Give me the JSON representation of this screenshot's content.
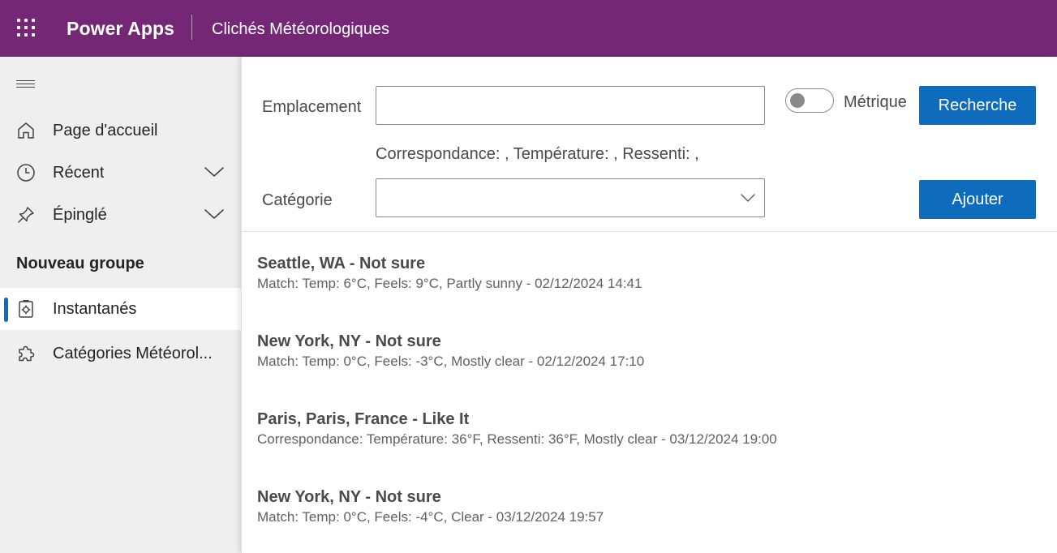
{
  "header": {
    "app_name": "Power Apps",
    "page_title": "Clichés Météorologiques",
    "bg_color": "#742774"
  },
  "sidebar": {
    "items": [
      {
        "label": "Page d'accueil",
        "icon": "home-icon"
      },
      {
        "label": "Récent",
        "icon": "clock-icon",
        "expandable": true
      },
      {
        "label": "Épinglé",
        "icon": "pin-icon",
        "expandable": true
      }
    ],
    "group_title": "Nouveau groupe",
    "group_items": [
      {
        "label": "Instantanés",
        "icon": "snapshot-icon",
        "selected": true
      },
      {
        "label": "Catégories Météorol...",
        "icon": "puzzle-icon",
        "selected": false
      }
    ]
  },
  "form": {
    "location_label": "Emplacement",
    "location_value": "",
    "metric_label": "Métrique",
    "metric_on": false,
    "search_button": "Recherche",
    "result_line": "Correspondance: , Température: , Ressenti: ,",
    "category_label": "Catégorie",
    "category_value": "",
    "add_button": "Ajouter",
    "accent_color": "#0f6cbd"
  },
  "snapshots": [
    {
      "title": "Seattle, WA - Not sure",
      "detail": "Match: Temp: 6°C, Feels: 9°C, Partly sunny - 02/12/2024 14:41"
    },
    {
      "title": "New York, NY - Not sure",
      "detail": "Match: Temp: 0°C, Feels: -3°C, Mostly clear - 02/12/2024 17:10"
    },
    {
      "title": "Paris, Paris, France - Like It",
      "detail": "Correspondance: Température: 36°F, Ressenti: 36°F, Mostly clear - 03/12/2024 19:00"
    },
    {
      "title": "New York, NY - Not sure",
      "detail": "Match: Temp: 0°C, Feels: -4°C, Clear - 03/12/2024 19:57"
    }
  ]
}
